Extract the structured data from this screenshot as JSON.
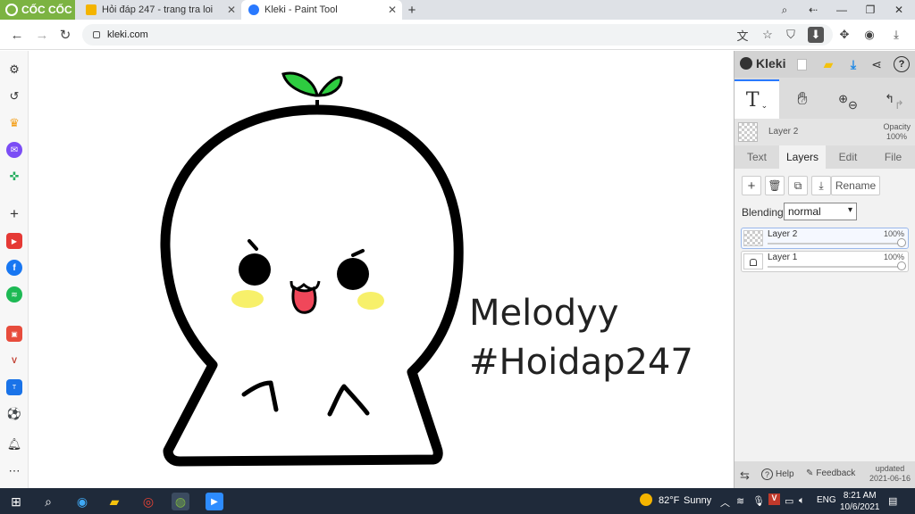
{
  "browser": {
    "brand": "CỐC CỐC",
    "tabs": [
      {
        "title": "Hỏi đáp 247 - trang tra loi",
        "active": false,
        "fav_color": "#f4b400"
      },
      {
        "title": "Kleki - Paint Tool",
        "active": true,
        "fav_color": "#2979ff"
      }
    ],
    "new_tab": "+",
    "url": "kleki.com"
  },
  "kleki": {
    "title": "Kleki",
    "current_layer": {
      "name": "Layer 2",
      "opacity_label": "Opacity",
      "opacity_value": "100%"
    },
    "tabs": [
      "Text",
      "Layers",
      "Edit",
      "File"
    ],
    "active_tab": "Layers",
    "rename_label": "Rename",
    "blending_label": "Blending",
    "blending_value": "normal",
    "layers": [
      {
        "name": "Layer 2",
        "opacity": "100%",
        "selected": true
      },
      {
        "name": "Layer 1",
        "opacity": "100%",
        "selected": false
      }
    ],
    "footer": {
      "help": "Help",
      "feedback": "Feedback",
      "updated_label": "updated",
      "updated_date": "2021-06-16"
    }
  },
  "drawing": {
    "line1": "Melodyy",
    "line2": "#Hoidap247"
  },
  "taskbar": {
    "weather_temp": "82°F",
    "weather_text": "Sunny",
    "lang": "ENG",
    "time": "8:21 AM",
    "date": "10/6/2021"
  },
  "colors": {
    "accent": "#2979ff",
    "brand_green": "#7cb342",
    "leaf": "#2ecc40",
    "blush": "#f7f06a",
    "tongue": "#f0475a"
  }
}
